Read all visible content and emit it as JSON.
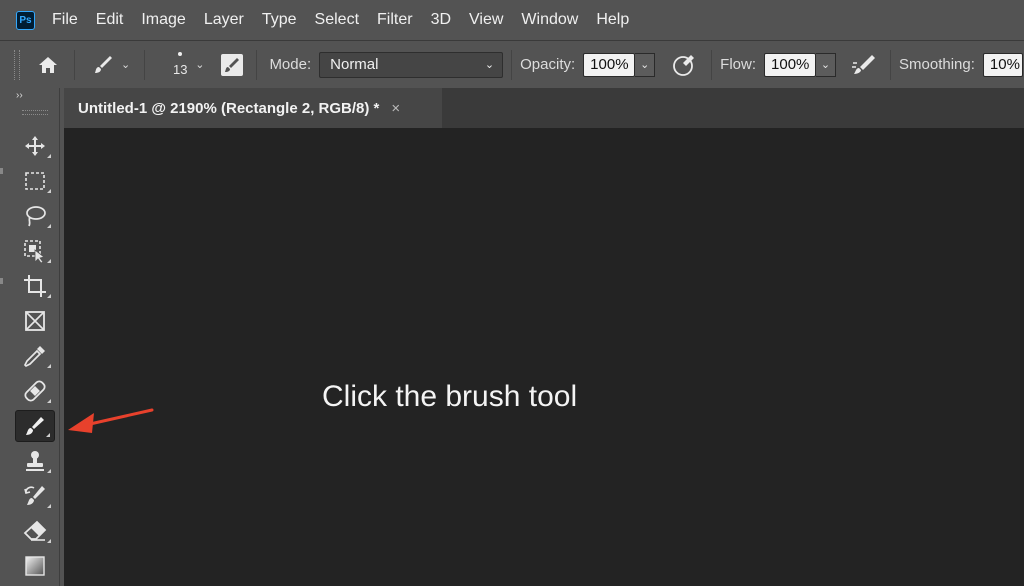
{
  "app": {
    "logo_text": "Ps"
  },
  "menu": [
    "File",
    "Edit",
    "Image",
    "Layer",
    "Type",
    "Select",
    "Filter",
    "3D",
    "View",
    "Window",
    "Help"
  ],
  "options_bar": {
    "brush_size": "13",
    "mode_label": "Mode:",
    "mode_value": "Normal",
    "opacity_label": "Opacity:",
    "opacity_value": "100%",
    "flow_label": "Flow:",
    "flow_value": "100%",
    "smoothing_label": "Smoothing:",
    "smoothing_value": "10%"
  },
  "toolbar": {
    "collapse_glyph": "››",
    "tools": [
      {
        "name": "move-tool",
        "icon": "move-icon"
      },
      {
        "name": "rectangular-marquee-tool",
        "icon": "marquee-icon"
      },
      {
        "name": "lasso-tool",
        "icon": "lasso-icon"
      },
      {
        "name": "object-selection-tool",
        "icon": "object-selection-icon"
      },
      {
        "name": "crop-tool",
        "icon": "crop-icon"
      },
      {
        "name": "frame-tool",
        "icon": "frame-icon"
      },
      {
        "name": "eyedropper-tool",
        "icon": "eyedropper-icon"
      },
      {
        "name": "spot-healing-brush-tool",
        "icon": "bandage-icon"
      },
      {
        "name": "brush-tool",
        "icon": "brush-icon",
        "active": true
      },
      {
        "name": "clone-stamp-tool",
        "icon": "stamp-icon"
      },
      {
        "name": "history-brush-tool",
        "icon": "history-brush-icon"
      },
      {
        "name": "eraser-tool",
        "icon": "eraser-icon"
      },
      {
        "name": "gradient-tool",
        "icon": "gradient-icon"
      }
    ]
  },
  "document_tab": {
    "title": "Untitled-1 @ 2190% (Rectangle 2, RGB/8) *",
    "close_glyph": "×"
  },
  "canvas": {
    "instruction": "Click the brush tool"
  },
  "colors": {
    "panel": "#535353",
    "canvas": "#232323",
    "arrow": "#e8412c"
  }
}
